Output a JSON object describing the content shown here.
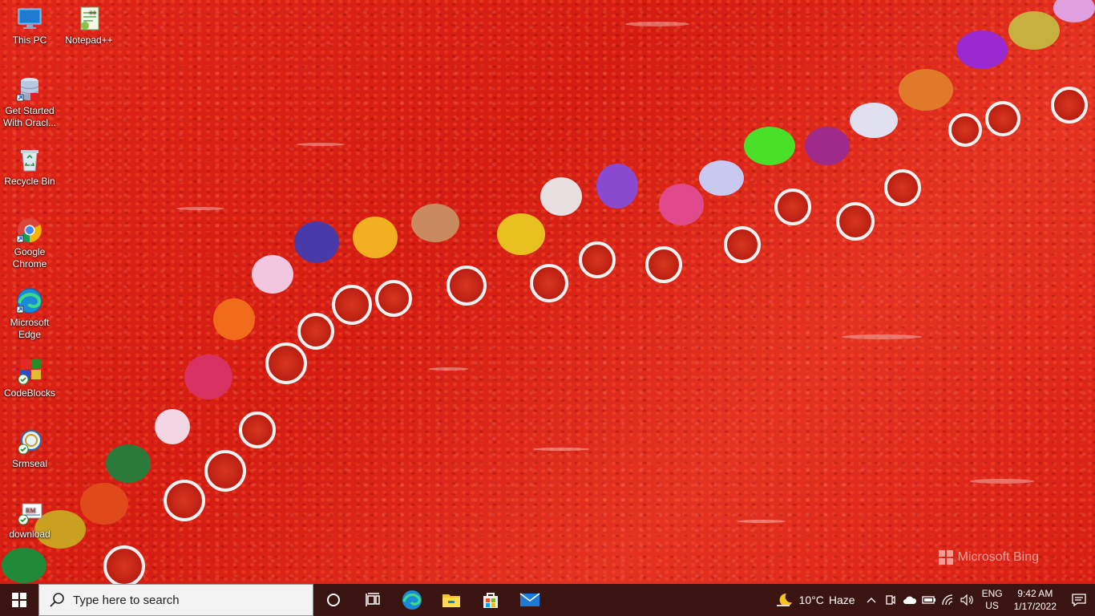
{
  "desktop": {
    "icons": [
      {
        "label": "This PC",
        "icon": "this-pc-icon"
      },
      {
        "label": "Notepad++",
        "icon": "notepad-plus-plus-icon"
      },
      {
        "label": "Get Started With Oracl...",
        "icon": "oracle-database-icon"
      },
      {
        "label": "Recycle Bin",
        "icon": "recycle-bin-icon"
      },
      {
        "label": "Google Chrome",
        "icon": "chrome-icon"
      },
      {
        "label": "Microsoft Edge",
        "icon": "edge-icon"
      },
      {
        "label": "CodeBlocks",
        "icon": "codeblocks-icon"
      },
      {
        "label": "Srmseal",
        "icon": "srmseal-icon"
      },
      {
        "label": "download",
        "icon": "download-file-icon"
      }
    ],
    "watermark": "Microsoft Bing"
  },
  "taskbar": {
    "search_placeholder": "Type here to search",
    "pinned": [
      "cortana-icon",
      "task-view-icon",
      "edge-icon",
      "file-explorer-icon",
      "microsoft-store-icon",
      "mail-icon"
    ],
    "weather": {
      "temp": "10°C",
      "condition": "Haze"
    },
    "language": {
      "lang": "ENG",
      "region": "US"
    },
    "clock": {
      "time": "9:42 AM",
      "date": "1/17/2022"
    }
  },
  "colors": {
    "taskbar_bg": "#3a1410",
    "wallpaper_red": "#d41c12",
    "search_bg": "#f3f3f3"
  }
}
